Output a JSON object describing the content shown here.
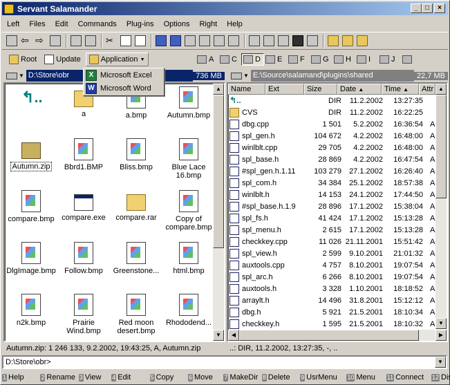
{
  "window": {
    "title": "Servant Salamander"
  },
  "menu": [
    "Left",
    "Files",
    "Edit",
    "Commands",
    "Plug-ins",
    "Options",
    "Right",
    "Help"
  ],
  "toolbar2": {
    "root": "Root",
    "update": "Update",
    "application": "Application"
  },
  "drives": [
    "A",
    "C",
    "D",
    "E",
    "F",
    "G",
    "H",
    "I",
    "J"
  ],
  "popup": {
    "items": [
      "Microsoft Excel",
      "Microsoft Word"
    ]
  },
  "left": {
    "path": "D:\\Store\\obr",
    "free": "736 MB",
    "items": [
      {
        "name": "",
        "icon": "up-dir-icon"
      },
      {
        "name": "a",
        "icon": "folder-icon"
      },
      {
        "name": "a.bmp",
        "icon": "bitmap-icon"
      },
      {
        "name": "Autumn.bmp",
        "icon": "bitmap-icon"
      },
      {
        "name": "Autumn.zip",
        "icon": "zip-archive-icon"
      },
      {
        "name": "Bbrd1.BMP",
        "icon": "bitmap-icon"
      },
      {
        "name": "Bliss.bmp",
        "icon": "bitmap-icon"
      },
      {
        "name": "Blue Lace 16.bmp",
        "icon": "bitmap-icon"
      },
      {
        "name": "compare.bmp",
        "icon": "bitmap-icon"
      },
      {
        "name": "compare.exe",
        "icon": "executable-icon"
      },
      {
        "name": "compare.rar",
        "icon": "rar-archive-icon"
      },
      {
        "name": "Copy of compare.bmp",
        "icon": "bitmap-icon"
      },
      {
        "name": "DlgImage.bmp",
        "icon": "bitmap-icon"
      },
      {
        "name": "Follow.bmp",
        "icon": "bitmap-icon"
      },
      {
        "name": "Greenstone...",
        "icon": "bitmap-icon"
      },
      {
        "name": "html.bmp",
        "icon": "bitmap-icon"
      },
      {
        "name": "n2k.bmp",
        "icon": "bitmap-icon"
      },
      {
        "name": "Prairie Wind.bmp",
        "icon": "bitmap-icon"
      },
      {
        "name": "Red moon desert.bmp",
        "icon": "bitmap-icon"
      },
      {
        "name": "Rhododend...",
        "icon": "bitmap-icon"
      }
    ],
    "status": "Autumn.zip: 1 246 133, 9.2.2002, 19:43:25, A, Autumn.zip"
  },
  "right": {
    "path": "E:\\Source\\salamand\\plugins\\shared",
    "free": "22,7 MB",
    "columns": [
      "Name",
      "Ext",
      "Size",
      "Date",
      "Time",
      "Attr"
    ],
    "rows": [
      {
        "name": "",
        "size": "DIR",
        "date": "11.2.2002",
        "time": "13:27:35",
        "attr": "",
        "icon": "up"
      },
      {
        "name": "CVS",
        "size": "DIR",
        "date": "11.2.2002",
        "time": "16:22:25",
        "attr": "",
        "icon": "folder"
      },
      {
        "name": "dbg.cpp",
        "size": "1 501",
        "date": "5.2.2002",
        "time": "16:36:54",
        "attr": "A",
        "icon": "cpp"
      },
      {
        "name": "spl_gen.h",
        "size": "104 672",
        "date": "4.2.2002",
        "time": "16:48:00",
        "attr": "A",
        "icon": "h"
      },
      {
        "name": "winlblt.cpp",
        "size": "29 705",
        "date": "4.2.2002",
        "time": "16:48:00",
        "attr": "A",
        "icon": "cpp"
      },
      {
        "name": "spl_base.h",
        "size": "28 869",
        "date": "4.2.2002",
        "time": "16:47:54",
        "attr": "A",
        "icon": "h"
      },
      {
        "name": "#spl_gen.h.1.11",
        "size": "103 279",
        "date": "27.1.2002",
        "time": "16:26:40",
        "attr": "A",
        "icon": "hash"
      },
      {
        "name": "spl_com.h",
        "size": "34 384",
        "date": "25.1.2002",
        "time": "18:57:38",
        "attr": "A",
        "icon": "h"
      },
      {
        "name": "winlblt.h",
        "size": "14 153",
        "date": "24.1.2002",
        "time": "17:44:50",
        "attr": "A",
        "icon": "h"
      },
      {
        "name": "#spl_base.h.1.9",
        "size": "28 896",
        "date": "17.1.2002",
        "time": "15:38:04",
        "attr": "A",
        "icon": "hash"
      },
      {
        "name": "spl_fs.h",
        "size": "41 424",
        "date": "17.1.2002",
        "time": "15:13:28",
        "attr": "A",
        "icon": "h"
      },
      {
        "name": "spl_menu.h",
        "size": "2 615",
        "date": "17.1.2002",
        "time": "15:13:28",
        "attr": "A",
        "icon": "h"
      },
      {
        "name": "checkkey.cpp",
        "size": "11 026",
        "date": "21.11.2001",
        "time": "15:51:42",
        "attr": "A",
        "icon": "cpp"
      },
      {
        "name": "spl_view.h",
        "size": "2 599",
        "date": "9.10.2001",
        "time": "21:01:32",
        "attr": "A",
        "icon": "h"
      },
      {
        "name": "auxtools.cpp",
        "size": "4 757",
        "date": "8.10.2001",
        "time": "19:07:54",
        "attr": "A",
        "icon": "cpp"
      },
      {
        "name": "spl_arc.h",
        "size": "6 266",
        "date": "8.10.2001",
        "time": "19:07:54",
        "attr": "A",
        "icon": "h"
      },
      {
        "name": "auxtools.h",
        "size": "3 328",
        "date": "1.10.2001",
        "time": "18:18:52",
        "attr": "A",
        "icon": "h"
      },
      {
        "name": "arraylt.h",
        "size": "14 496",
        "date": "31.8.2001",
        "time": "15:12:12",
        "attr": "A",
        "icon": "h"
      },
      {
        "name": "dbg.h",
        "size": "5 921",
        "date": "21.5.2001",
        "time": "18:10:34",
        "attr": "A",
        "icon": "h"
      },
      {
        "name": "checkkey.h",
        "size": "1 595",
        "date": "21.5.2001",
        "time": "18:10:32",
        "attr": "A",
        "icon": "h"
      }
    ],
    "status": "..: DIR, 11.2.2002, 13:27:35, -, .."
  },
  "cmdline": {
    "value": "D:\\Store\\obr>"
  },
  "fkeys": [
    {
      "n": "1",
      "label": "Help"
    },
    {
      "n": "2",
      "label": "Rename"
    },
    {
      "n": "3",
      "label": "View"
    },
    {
      "n": "4",
      "label": "Edit"
    },
    {
      "n": "5",
      "label": "Copy"
    },
    {
      "n": "6",
      "label": "Move"
    },
    {
      "n": "7",
      "label": "MakeDir"
    },
    {
      "n": "8",
      "label": "Delete"
    },
    {
      "n": "9",
      "label": "UsrMenu"
    },
    {
      "n": "10",
      "label": "Menu"
    },
    {
      "n": "11",
      "label": "Connect"
    },
    {
      "n": "12",
      "label": "Dis"
    }
  ]
}
